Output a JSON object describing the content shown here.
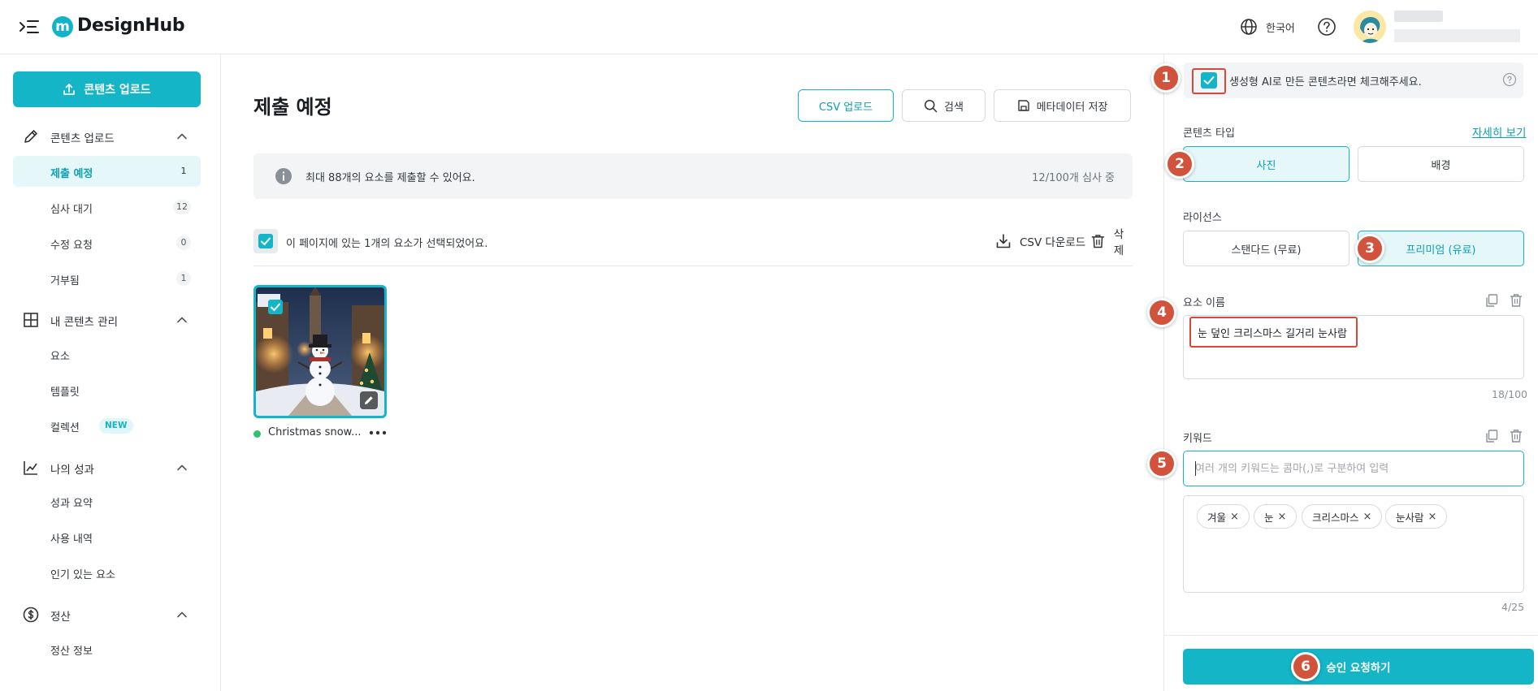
{
  "header": {
    "logo_mark": "m",
    "logo_text": "DesignHub",
    "language": "한국어"
  },
  "sidebar": {
    "upload_button": "콘텐츠 업로드",
    "sections": [
      {
        "label": "콘텐츠 업로드",
        "icon": "pencil-icon"
      },
      {
        "label": "내 콘텐츠 관리",
        "icon": "grid-icon"
      },
      {
        "label": "나의 성과",
        "icon": "chart-line-icon"
      },
      {
        "label": "정산",
        "icon": "dollar-circle-icon"
      }
    ],
    "items": [
      {
        "label": "제출 예정",
        "count": "1"
      },
      {
        "label": "심사 대기",
        "count": "12"
      },
      {
        "label": "수정 요청",
        "count": "0"
      },
      {
        "label": "거부됨",
        "count": "1"
      },
      {
        "label": "요소"
      },
      {
        "label": "템플릿"
      },
      {
        "label": "컬렉션",
        "badge": "NEW"
      },
      {
        "label": "성과 요약"
      },
      {
        "label": "사용 내역"
      },
      {
        "label": "인기 있는 요소"
      },
      {
        "label": "정산 정보"
      }
    ]
  },
  "main": {
    "title": "제출 예정",
    "buttons": {
      "csv_upload": "CSV 업로드",
      "search": "검색",
      "save_metadata": "메타데이터 저장"
    },
    "info": {
      "message": "최대 88개의 요소를 제출할 수 있어요.",
      "status": "12/100개 심사 중"
    },
    "selection": {
      "text": "이 페이지에 있는 1개의 요소가 선택되었어요.",
      "csv_download": "CSV 다운로드",
      "delete": "삭제"
    },
    "items": [
      {
        "name": "Christmas snow...",
        "status_color": "#2dc26b"
      }
    ]
  },
  "panel": {
    "ai_label": "생성형 AI로 만든 콘텐츠라면 체크해주세요.",
    "content_type": {
      "label": "콘텐츠 타입",
      "detail_link": "자세히 보기",
      "options": [
        "사진",
        "배경"
      ],
      "selected": "사진"
    },
    "license": {
      "label": "라이선스",
      "options": [
        "스탠다드 (무료)",
        "프리미엄 (유료)"
      ],
      "selected": "프리미엄 (유료)"
    },
    "element_name": {
      "label": "요소 이름",
      "value": "눈 덮인 크리스마스 길거리 눈사람",
      "counter": "18/100"
    },
    "keywords": {
      "label": "키워드",
      "placeholder": "여러 개의 키워드는 콤마(,)로 구분하여 입력",
      "tags": [
        "겨울",
        "눈",
        "크리스마스",
        "눈사람"
      ],
      "counter": "4/25"
    },
    "submit": "승인 요청하기"
  },
  "markers": [
    "1",
    "2",
    "3",
    "4",
    "5",
    "6"
  ],
  "colors": {
    "accent": "#15b5c8",
    "accent_dark": "#0d9fb2",
    "accent_light": "#e6f7f9",
    "marker": "#d2533b",
    "highlight_frame": "#d9463a",
    "status_ok": "#2dc26b"
  }
}
